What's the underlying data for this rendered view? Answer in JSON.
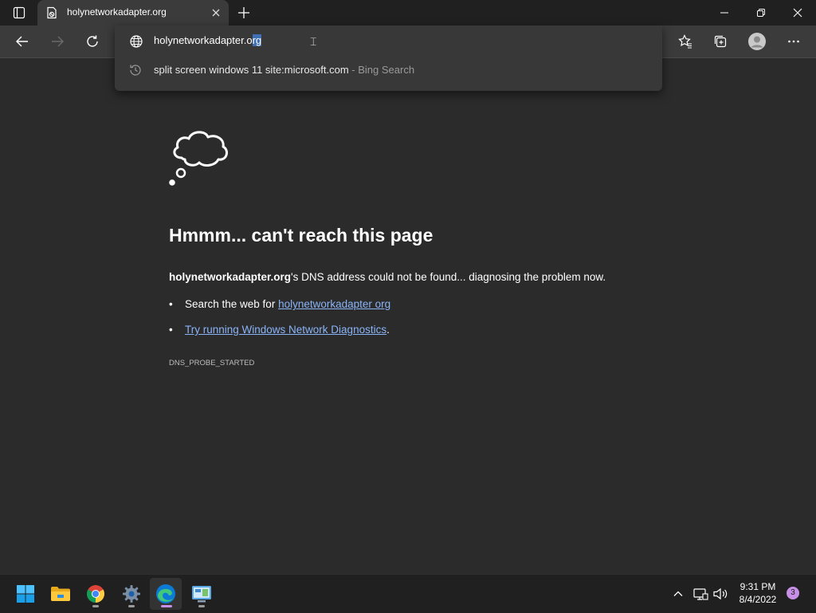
{
  "tab": {
    "title": "holynetworkadapter.org"
  },
  "address_bar": {
    "value_prefix": "holynetworkadapter.o",
    "value_selected": "rg",
    "suggestion": {
      "query": "split screen windows 11 site:microsoft.com",
      "source": " - Bing Search"
    }
  },
  "error_page": {
    "title": "Hmmm... can't reach this page",
    "host": "holynetworkadapter.org",
    "description_rest": "'s DNS address could not be found... diagnosing the problem now.",
    "items": [
      {
        "prefix": "Search the web for ",
        "link": "holynetworkadapter org",
        "suffix": ""
      },
      {
        "prefix": "",
        "link": "Try running Windows Network Diagnostics",
        "suffix": "."
      }
    ],
    "error_code": "DNS_PROBE_STARTED"
  },
  "taskbar": {
    "apps": [
      {
        "name": "start",
        "icon": "windows-logo-icon",
        "active": false
      },
      {
        "name": "file-explorer",
        "icon": "folder-icon",
        "active": false
      },
      {
        "name": "chrome",
        "icon": "chrome-icon",
        "active": false
      },
      {
        "name": "settings",
        "icon": "gear-icon",
        "active": false
      },
      {
        "name": "edge",
        "icon": "edge-icon",
        "active": true
      },
      {
        "name": "control-panel",
        "icon": "control-panel-icon",
        "active": false
      }
    ],
    "time": "9:31 PM",
    "date": "8/4/2022",
    "notification_count": "3"
  },
  "colors": {
    "page_background": "#2b2b2b",
    "toolbar": "#3b3b3b",
    "link": "#8ab4f8",
    "selection": "#3f6fb5",
    "accent": "#c78fe6"
  }
}
